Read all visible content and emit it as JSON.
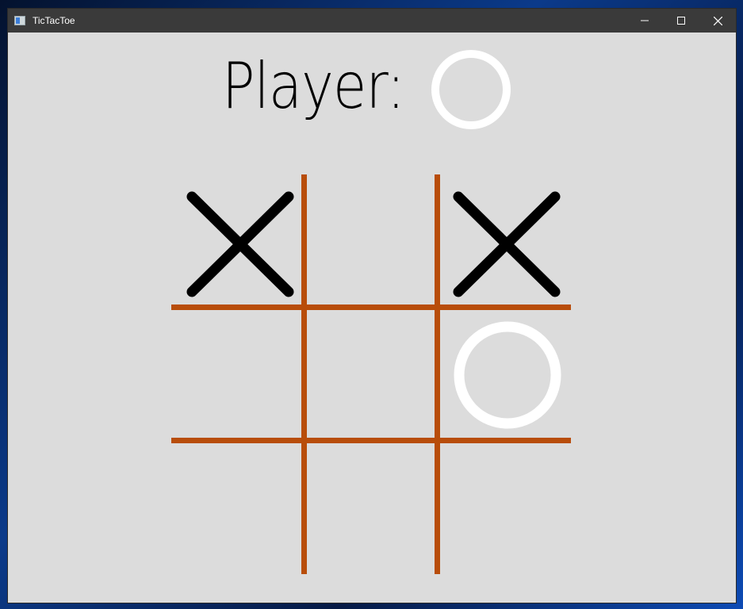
{
  "window": {
    "title": "TicTacToe",
    "icon": "app-icon"
  },
  "controls": {
    "minimize": "minimize-icon",
    "maximize": "maximize-icon",
    "close": "close-icon"
  },
  "header": {
    "label": "Player:",
    "current_player": "O"
  },
  "board": {
    "cells": [
      "X",
      "",
      "X",
      "",
      "",
      "O",
      "",
      "",
      ""
    ]
  },
  "colors": {
    "grid": "#b84d0a",
    "x_mark": "#000000",
    "o_mark": "#ffffff",
    "background": "#dcdcdc",
    "titlebar": "#3a3a3a"
  }
}
